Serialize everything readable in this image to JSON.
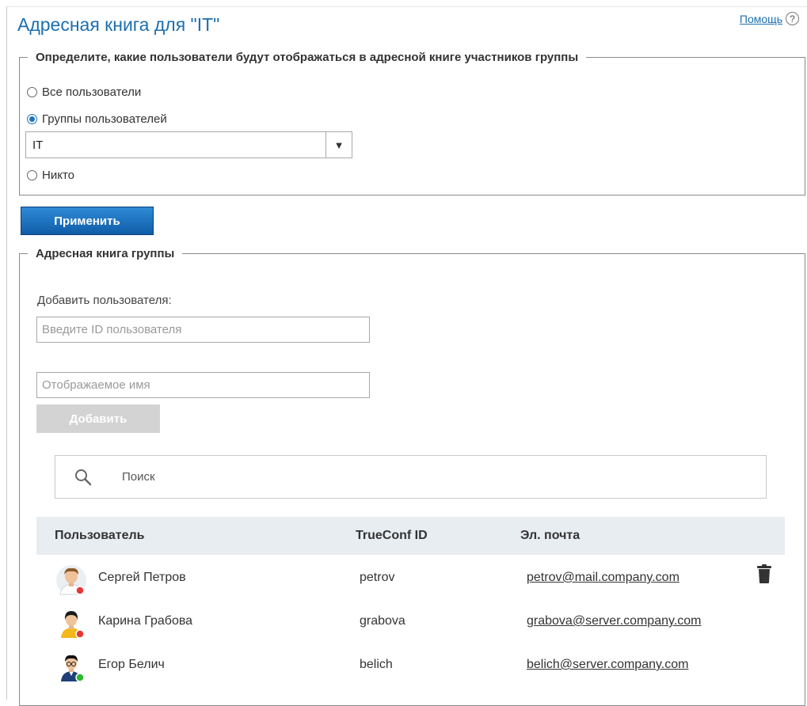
{
  "header": {
    "title": "Адресная книга для \"IT\"",
    "help_label": "Помощь",
    "help_icon": "question-circle-icon"
  },
  "visibility": {
    "legend": "Определите, какие пользователи будут отображаться в адресной книге участников группы",
    "options": [
      {
        "label": "Все пользователи",
        "checked": false
      },
      {
        "label": "Группы пользователей",
        "checked": true
      },
      {
        "label": "Никто",
        "checked": false
      }
    ],
    "group_select_value": "IT",
    "apply_label": "Применить"
  },
  "address_book": {
    "legend": "Адресная книга группы",
    "add_user_label": "Добавить пользователя:",
    "user_id_placeholder": "Введите ID пользователя",
    "display_name_placeholder": "Отображаемое имя",
    "add_button_label": "Добавить",
    "search_placeholder": "Поиск",
    "columns": [
      "Пользователь",
      "TrueConf ID",
      "Эл. почта"
    ],
    "rows": [
      {
        "name": "Сергей Петров",
        "id": "petrov",
        "email": "petrov@mail.company.com",
        "status_color": "#e53935"
      },
      {
        "name": "Карина Грабова",
        "id": "grabova",
        "email": "grabova@server.company.com",
        "status_color": "#e53935"
      },
      {
        "name": "Егор Белич",
        "id": "belich",
        "email": "belich@server.company.com",
        "status_color": "#2eb82e"
      }
    ]
  },
  "colors": {
    "accent": "#1c6fb0",
    "primary_button": "#1a6fc0",
    "disabled_button": "#d3d3d3",
    "table_header_bg": "#e8edf2"
  }
}
